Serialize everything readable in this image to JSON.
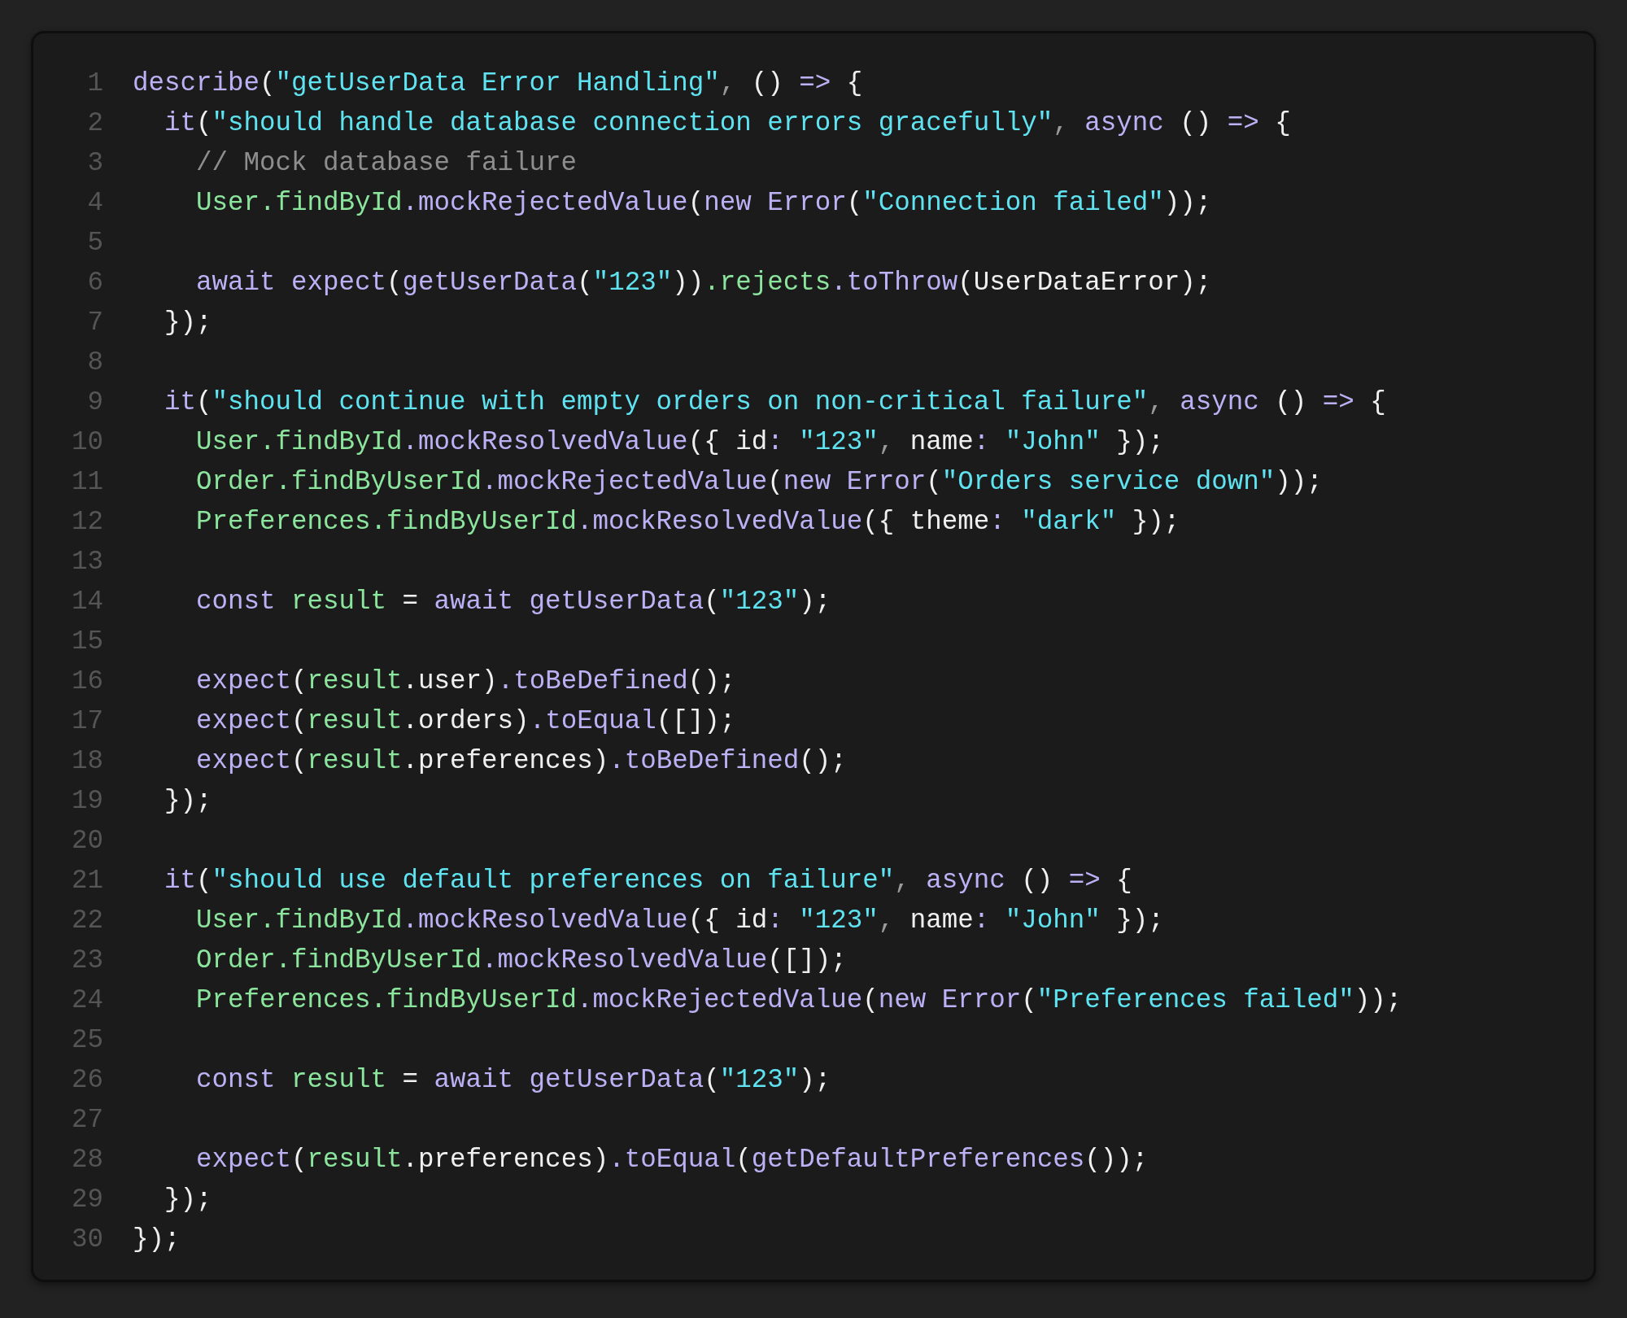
{
  "editor": {
    "lines": [
      {
        "number": "1",
        "tokens": [
          {
            "kind": "keyword",
            "text": "describe"
          },
          {
            "kind": "plain",
            "text": "("
          },
          {
            "kind": "string",
            "text": "\"getUserData Error Handling\""
          },
          {
            "kind": "punct",
            "text": ","
          },
          {
            "kind": "plain",
            "text": " () "
          },
          {
            "kind": "keyword",
            "text": "=>"
          },
          {
            "kind": "plain",
            "text": " {"
          }
        ]
      },
      {
        "number": "2",
        "tokens": [
          {
            "kind": "keyword",
            "text": "  it"
          },
          {
            "kind": "plain",
            "text": "("
          },
          {
            "kind": "string",
            "text": "\"should handle database connection errors gracefully\""
          },
          {
            "kind": "punct",
            "text": ", "
          },
          {
            "kind": "keyword",
            "text": "async"
          },
          {
            "kind": "plain",
            "text": " () "
          },
          {
            "kind": "keyword",
            "text": "=>"
          },
          {
            "kind": "plain",
            "text": " {"
          }
        ]
      },
      {
        "number": "3",
        "tokens": [
          {
            "kind": "comment",
            "text": "    // Mock database failure"
          }
        ]
      },
      {
        "number": "4",
        "tokens": [
          {
            "kind": "name",
            "text": "    User.findById"
          },
          {
            "kind": "keyword",
            "text": ".mockRejectedValue"
          },
          {
            "kind": "plain",
            "text": "("
          },
          {
            "kind": "keyword",
            "text": "new Error"
          },
          {
            "kind": "plain",
            "text": "("
          },
          {
            "kind": "string",
            "text": "\"Connection failed\""
          },
          {
            "kind": "plain",
            "text": "));"
          }
        ]
      },
      {
        "number": "5"
      },
      {
        "number": "6",
        "tokens": [
          {
            "kind": "keyword",
            "text": "    await expect"
          },
          {
            "kind": "plain",
            "text": "("
          },
          {
            "kind": "keyword",
            "text": "getUserData"
          },
          {
            "kind": "plain",
            "text": "("
          },
          {
            "kind": "string",
            "text": "\"123\""
          },
          {
            "kind": "plain",
            "text": "))"
          },
          {
            "kind": "name",
            "text": ".rejects"
          },
          {
            "kind": "keyword",
            "text": ".toThrow"
          },
          {
            "kind": "plain",
            "text": "(UserDataError);"
          }
        ]
      },
      {
        "number": "7",
        "tokens": [
          {
            "kind": "plain",
            "text": "  });"
          }
        ]
      },
      {
        "number": "8"
      },
      {
        "number": "9",
        "tokens": [
          {
            "kind": "keyword",
            "text": "  it"
          },
          {
            "kind": "plain",
            "text": "("
          },
          {
            "kind": "string",
            "text": "\"should continue with empty orders on non-critical failure\""
          },
          {
            "kind": "punct",
            "text": ", "
          },
          {
            "kind": "keyword",
            "text": "async"
          },
          {
            "kind": "plain",
            "text": " () "
          },
          {
            "kind": "keyword",
            "text": "=>"
          },
          {
            "kind": "plain",
            "text": " {"
          }
        ]
      },
      {
        "number": "10",
        "tokens": [
          {
            "kind": "name",
            "text": "    User.findById"
          },
          {
            "kind": "keyword",
            "text": ".mockResolvedValue"
          },
          {
            "kind": "plain",
            "text": "({ id"
          },
          {
            "kind": "keyword",
            "text": ": "
          },
          {
            "kind": "string",
            "text": "\"123\""
          },
          {
            "kind": "punct",
            "text": ","
          },
          {
            "kind": "plain",
            "text": " name"
          },
          {
            "kind": "keyword",
            "text": ": "
          },
          {
            "kind": "string",
            "text": "\"John\""
          },
          {
            "kind": "plain",
            "text": " });"
          }
        ]
      },
      {
        "number": "11",
        "tokens": [
          {
            "kind": "name",
            "text": "    Order.findByUserId"
          },
          {
            "kind": "keyword",
            "text": ".mockRejectedValue"
          },
          {
            "kind": "plain",
            "text": "("
          },
          {
            "kind": "keyword",
            "text": "new Error"
          },
          {
            "kind": "plain",
            "text": "("
          },
          {
            "kind": "string",
            "text": "\"Orders service down\""
          },
          {
            "kind": "plain",
            "text": "));"
          }
        ]
      },
      {
        "number": "12",
        "tokens": [
          {
            "kind": "name",
            "text": "    Preferences.findByUserId"
          },
          {
            "kind": "keyword",
            "text": ".mockResolvedValue"
          },
          {
            "kind": "plain",
            "text": "({ theme"
          },
          {
            "kind": "keyword",
            "text": ": "
          },
          {
            "kind": "string",
            "text": "\"dark\""
          },
          {
            "kind": "plain",
            "text": " });"
          }
        ]
      },
      {
        "number": "13"
      },
      {
        "number": "14",
        "tokens": [
          {
            "kind": "keyword",
            "text": "    const "
          },
          {
            "kind": "name",
            "text": "result"
          },
          {
            "kind": "plain",
            "text": " = "
          },
          {
            "kind": "keyword",
            "text": "await getUserData"
          },
          {
            "kind": "plain",
            "text": "("
          },
          {
            "kind": "string",
            "text": "\"123\""
          },
          {
            "kind": "plain",
            "text": ");"
          }
        ]
      },
      {
        "number": "15"
      },
      {
        "number": "16",
        "tokens": [
          {
            "kind": "keyword",
            "text": "    expect"
          },
          {
            "kind": "plain",
            "text": "("
          },
          {
            "kind": "name",
            "text": "result"
          },
          {
            "kind": "plain",
            "text": ".user)"
          },
          {
            "kind": "keyword",
            "text": ".toBeDefined"
          },
          {
            "kind": "plain",
            "text": "();"
          }
        ]
      },
      {
        "number": "17",
        "tokens": [
          {
            "kind": "keyword",
            "text": "    expect"
          },
          {
            "kind": "plain",
            "text": "("
          },
          {
            "kind": "name",
            "text": "result"
          },
          {
            "kind": "plain",
            "text": ".orders)"
          },
          {
            "kind": "keyword",
            "text": ".toEqual"
          },
          {
            "kind": "plain",
            "text": "([]);"
          }
        ]
      },
      {
        "number": "18",
        "tokens": [
          {
            "kind": "keyword",
            "text": "    expect"
          },
          {
            "kind": "plain",
            "text": "("
          },
          {
            "kind": "name",
            "text": "result"
          },
          {
            "kind": "plain",
            "text": ".preferences)"
          },
          {
            "kind": "keyword",
            "text": ".toBeDefined"
          },
          {
            "kind": "plain",
            "text": "();"
          }
        ]
      },
      {
        "number": "19",
        "tokens": [
          {
            "kind": "plain",
            "text": "  });"
          }
        ]
      },
      {
        "number": "20"
      },
      {
        "number": "21",
        "tokens": [
          {
            "kind": "keyword",
            "text": "  it"
          },
          {
            "kind": "plain",
            "text": "("
          },
          {
            "kind": "string",
            "text": "\"should use default preferences on failure\""
          },
          {
            "kind": "punct",
            "text": ", "
          },
          {
            "kind": "keyword",
            "text": "async"
          },
          {
            "kind": "plain",
            "text": " () "
          },
          {
            "kind": "keyword",
            "text": "=>"
          },
          {
            "kind": "plain",
            "text": " {"
          }
        ]
      },
      {
        "number": "22",
        "tokens": [
          {
            "kind": "name",
            "text": "    User.findById"
          },
          {
            "kind": "keyword",
            "text": ".mockResolvedValue"
          },
          {
            "kind": "plain",
            "text": "({ id"
          },
          {
            "kind": "keyword",
            "text": ": "
          },
          {
            "kind": "string",
            "text": "\"123\""
          },
          {
            "kind": "punct",
            "text": ","
          },
          {
            "kind": "plain",
            "text": " name"
          },
          {
            "kind": "keyword",
            "text": ": "
          },
          {
            "kind": "string",
            "text": "\"John\""
          },
          {
            "kind": "plain",
            "text": " });"
          }
        ]
      },
      {
        "number": "23",
        "tokens": [
          {
            "kind": "name",
            "text": "    Order.findByUserId"
          },
          {
            "kind": "keyword",
            "text": ".mockResolvedValue"
          },
          {
            "kind": "plain",
            "text": "([]);"
          }
        ]
      },
      {
        "number": "24",
        "tokens": [
          {
            "kind": "name",
            "text": "    Preferences.findByUserId"
          },
          {
            "kind": "keyword",
            "text": ".mockRejectedValue"
          },
          {
            "kind": "plain",
            "text": "("
          },
          {
            "kind": "keyword",
            "text": "new Error"
          },
          {
            "kind": "plain",
            "text": "("
          },
          {
            "kind": "string",
            "text": "\"Preferences failed\""
          },
          {
            "kind": "plain",
            "text": "));"
          }
        ]
      },
      {
        "number": "25"
      },
      {
        "number": "26",
        "tokens": [
          {
            "kind": "keyword",
            "text": "    const "
          },
          {
            "kind": "name",
            "text": "result"
          },
          {
            "kind": "plain",
            "text": " = "
          },
          {
            "kind": "keyword",
            "text": "await getUserData"
          },
          {
            "kind": "plain",
            "text": "("
          },
          {
            "kind": "string",
            "text": "\"123\""
          },
          {
            "kind": "plain",
            "text": ");"
          }
        ]
      },
      {
        "number": "27"
      },
      {
        "number": "28",
        "tokens": [
          {
            "kind": "keyword",
            "text": "    expect"
          },
          {
            "kind": "plain",
            "text": "("
          },
          {
            "kind": "name",
            "text": "result"
          },
          {
            "kind": "plain",
            "text": ".preferences)"
          },
          {
            "kind": "keyword",
            "text": ".toEqual"
          },
          {
            "kind": "plain",
            "text": "("
          },
          {
            "kind": "keyword",
            "text": "getDefaultPreferences"
          },
          {
            "kind": "plain",
            "text": "());"
          }
        ]
      },
      {
        "number": "29",
        "tokens": [
          {
            "kind": "plain",
            "text": "  });"
          }
        ]
      },
      {
        "number": "30",
        "tokens": [
          {
            "kind": "plain",
            "text": "});"
          }
        ]
      }
    ]
  }
}
